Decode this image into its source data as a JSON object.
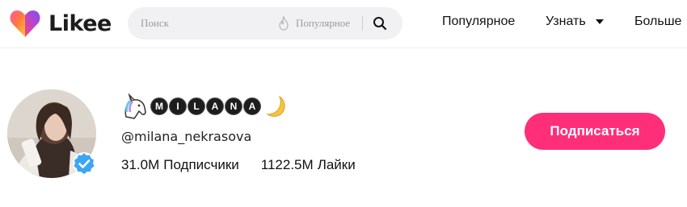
{
  "brand": {
    "name": "Likee",
    "accent": "#ff2e79"
  },
  "search": {
    "placeholder": "Поиск",
    "trend_label": "Популярное"
  },
  "nav": {
    "popular": "Популярное",
    "learn": "Узнать",
    "more": "Больше"
  },
  "profile": {
    "display_name_letters": [
      "M",
      "I",
      "L",
      "A",
      "N",
      "A"
    ],
    "username": "@milana_nekrasova",
    "verified": true,
    "stats": [
      {
        "value": "31.0M",
        "label": "Подписчики"
      },
      {
        "value": "1122.5M",
        "label": "Лайки"
      }
    ],
    "follow_label": "Подписаться"
  },
  "icons": [
    "likee-logo-icon",
    "flame-icon",
    "search-icon",
    "chevron-down-icon",
    "unicorn-icon",
    "crescent-moon-icon",
    "verified-badge-icon"
  ]
}
